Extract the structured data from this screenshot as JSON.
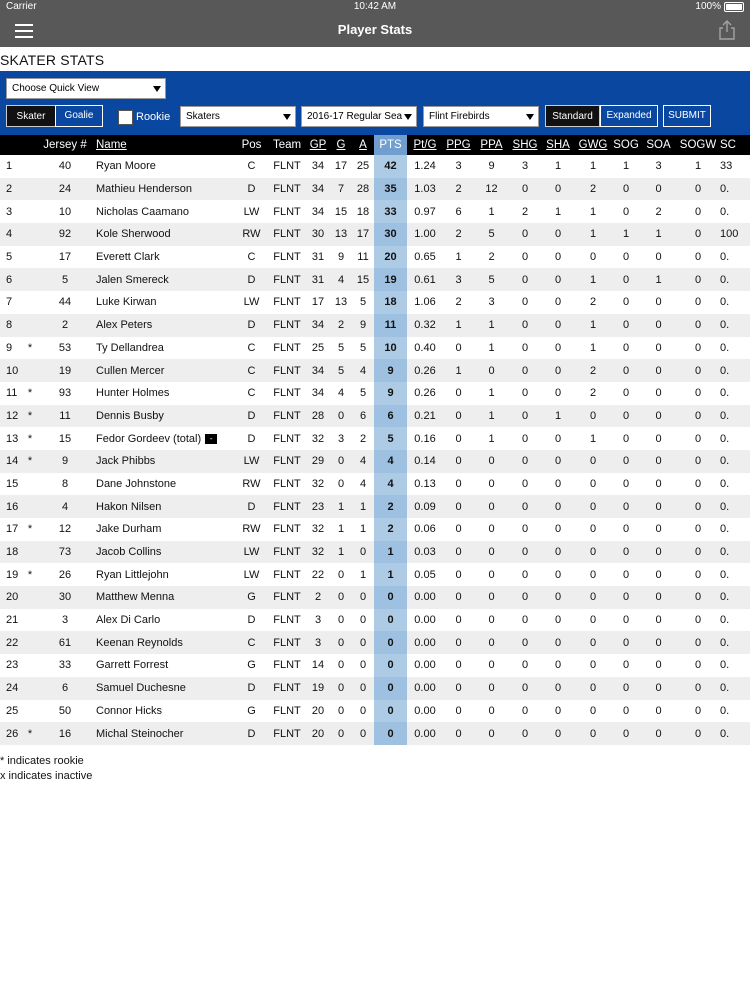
{
  "status": {
    "carrier": "Carrier",
    "time": "10:42 AM",
    "battery": "100%"
  },
  "nav": {
    "title": "Player Stats",
    "menu_icon": "hamburger-icon",
    "share_icon": "share-icon"
  },
  "section_title": "SKATER STATS",
  "toolbar": {
    "quick_view": "Choose Quick View",
    "skater": "Skater",
    "goalie": "Goalie",
    "rookie": "Rookie",
    "type": "Skaters",
    "season": "2016-17 Regular Sea",
    "team": "Flint Firebirds",
    "standard": "Standard",
    "expanded": "Expanded",
    "submit": "SUBMIT"
  },
  "headers": [
    "",
    "",
    "Jersey #",
    "Name",
    "Pos",
    "Team",
    "GP",
    "G",
    "A",
    "PTS",
    "Pt/G",
    "PPG",
    "PPA",
    "SHG",
    "SHA",
    "GWG",
    "SOG",
    "SOA",
    "SOGW",
    "SC"
  ],
  "players": [
    {
      "rank": "1",
      "rookie": "",
      "jersey": "40",
      "name": "Ryan Moore",
      "pos": "C",
      "team": "FLNT",
      "gp": "34",
      "g": "17",
      "a": "25",
      "pts": "42",
      "ptg": "1.24",
      "ppg": "3",
      "ppa": "9",
      "shg": "3",
      "sha": "1",
      "gwg": "1",
      "sog": "1",
      "soa": "3",
      "sogw": "1",
      "sc": "33"
    },
    {
      "rank": "2",
      "rookie": "",
      "jersey": "24",
      "name": "Mathieu Henderson",
      "pos": "D",
      "team": "FLNT",
      "gp": "34",
      "g": "7",
      "a": "28",
      "pts": "35",
      "ptg": "1.03",
      "ppg": "2",
      "ppa": "12",
      "shg": "0",
      "sha": "0",
      "gwg": "2",
      "sog": "0",
      "soa": "0",
      "sogw": "0",
      "sc": "0."
    },
    {
      "rank": "3",
      "rookie": "",
      "jersey": "10",
      "name": "Nicholas Caamano",
      "pos": "LW",
      "team": "FLNT",
      "gp": "34",
      "g": "15",
      "a": "18",
      "pts": "33",
      "ptg": "0.97",
      "ppg": "6",
      "ppa": "1",
      "shg": "2",
      "sha": "1",
      "gwg": "1",
      "sog": "0",
      "soa": "2",
      "sogw": "0",
      "sc": "0."
    },
    {
      "rank": "4",
      "rookie": "",
      "jersey": "92",
      "name": "Kole Sherwood",
      "pos": "RW",
      "team": "FLNT",
      "gp": "30",
      "g": "13",
      "a": "17",
      "pts": "30",
      "ptg": "1.00",
      "ppg": "2",
      "ppa": "5",
      "shg": "0",
      "sha": "0",
      "gwg": "1",
      "sog": "1",
      "soa": "1",
      "sogw": "0",
      "sc": "100"
    },
    {
      "rank": "5",
      "rookie": "",
      "jersey": "17",
      "name": "Everett Clark",
      "pos": "C",
      "team": "FLNT",
      "gp": "31",
      "g": "9",
      "a": "11",
      "pts": "20",
      "ptg": "0.65",
      "ppg": "1",
      "ppa": "2",
      "shg": "0",
      "sha": "0",
      "gwg": "0",
      "sog": "0",
      "soa": "0",
      "sogw": "0",
      "sc": "0."
    },
    {
      "rank": "6",
      "rookie": "",
      "jersey": "5",
      "name": "Jalen Smereck",
      "pos": "D",
      "team": "FLNT",
      "gp": "31",
      "g": "4",
      "a": "15",
      "pts": "19",
      "ptg": "0.61",
      "ppg": "3",
      "ppa": "5",
      "shg": "0",
      "sha": "0",
      "gwg": "1",
      "sog": "0",
      "soa": "1",
      "sogw": "0",
      "sc": "0."
    },
    {
      "rank": "7",
      "rookie": "",
      "jersey": "44",
      "name": "Luke Kirwan",
      "pos": "LW",
      "team": "FLNT",
      "gp": "17",
      "g": "13",
      "a": "5",
      "pts": "18",
      "ptg": "1.06",
      "ppg": "2",
      "ppa": "3",
      "shg": "0",
      "sha": "0",
      "gwg": "2",
      "sog": "0",
      "soa": "0",
      "sogw": "0",
      "sc": "0."
    },
    {
      "rank": "8",
      "rookie": "",
      "jersey": "2",
      "name": "Alex Peters",
      "pos": "D",
      "team": "FLNT",
      "gp": "34",
      "g": "2",
      "a": "9",
      "pts": "11",
      "ptg": "0.32",
      "ppg": "1",
      "ppa": "1",
      "shg": "0",
      "sha": "0",
      "gwg": "1",
      "sog": "0",
      "soa": "0",
      "sogw": "0",
      "sc": "0."
    },
    {
      "rank": "9",
      "rookie": "*",
      "jersey": "53",
      "name": "Ty Dellandrea",
      "pos": "C",
      "team": "FLNT",
      "gp": "25",
      "g": "5",
      "a": "5",
      "pts": "10",
      "ptg": "0.40",
      "ppg": "0",
      "ppa": "1",
      "shg": "0",
      "sha": "0",
      "gwg": "1",
      "sog": "0",
      "soa": "0",
      "sogw": "0",
      "sc": "0."
    },
    {
      "rank": "10",
      "rookie": "",
      "jersey": "19",
      "name": "Cullen Mercer",
      "pos": "C",
      "team": "FLNT",
      "gp": "34",
      "g": "5",
      "a": "4",
      "pts": "9",
      "ptg": "0.26",
      "ppg": "1",
      "ppa": "0",
      "shg": "0",
      "sha": "0",
      "gwg": "2",
      "sog": "0",
      "soa": "0",
      "sogw": "0",
      "sc": "0."
    },
    {
      "rank": "11",
      "rookie": "*",
      "jersey": "93",
      "name": "Hunter Holmes",
      "pos": "C",
      "team": "FLNT",
      "gp": "34",
      "g": "4",
      "a": "5",
      "pts": "9",
      "ptg": "0.26",
      "ppg": "0",
      "ppa": "1",
      "shg": "0",
      "sha": "0",
      "gwg": "2",
      "sog": "0",
      "soa": "0",
      "sogw": "0",
      "sc": "0."
    },
    {
      "rank": "12",
      "rookie": "*",
      "jersey": "11",
      "name": "Dennis Busby",
      "pos": "D",
      "team": "FLNT",
      "gp": "28",
      "g": "0",
      "a": "6",
      "pts": "6",
      "ptg": "0.21",
      "ppg": "0",
      "ppa": "1",
      "shg": "0",
      "sha": "1",
      "gwg": "0",
      "sog": "0",
      "soa": "0",
      "sogw": "0",
      "sc": "0."
    },
    {
      "rank": "13",
      "rookie": "*",
      "jersey": "15",
      "name": "Fedor Gordeev (total)",
      "pos": "D",
      "team": "FLNT",
      "gp": "32",
      "g": "3",
      "a": "2",
      "pts": "5",
      "ptg": "0.16",
      "ppg": "0",
      "ppa": "1",
      "shg": "0",
      "sha": "0",
      "gwg": "1",
      "sog": "0",
      "soa": "0",
      "sogw": "0",
      "sc": "0.",
      "badge": "-"
    },
    {
      "rank": "14",
      "rookie": "*",
      "jersey": "9",
      "name": "Jack Phibbs",
      "pos": "LW",
      "team": "FLNT",
      "gp": "29",
      "g": "0",
      "a": "4",
      "pts": "4",
      "ptg": "0.14",
      "ppg": "0",
      "ppa": "0",
      "shg": "0",
      "sha": "0",
      "gwg": "0",
      "sog": "0",
      "soa": "0",
      "sogw": "0",
      "sc": "0."
    },
    {
      "rank": "15",
      "rookie": "",
      "jersey": "8",
      "name": "Dane Johnstone",
      "pos": "RW",
      "team": "FLNT",
      "gp": "32",
      "g": "0",
      "a": "4",
      "pts": "4",
      "ptg": "0.13",
      "ppg": "0",
      "ppa": "0",
      "shg": "0",
      "sha": "0",
      "gwg": "0",
      "sog": "0",
      "soa": "0",
      "sogw": "0",
      "sc": "0."
    },
    {
      "rank": "16",
      "rookie": "",
      "jersey": "4",
      "name": "Hakon Nilsen",
      "pos": "D",
      "team": "FLNT",
      "gp": "23",
      "g": "1",
      "a": "1",
      "pts": "2",
      "ptg": "0.09",
      "ppg": "0",
      "ppa": "0",
      "shg": "0",
      "sha": "0",
      "gwg": "0",
      "sog": "0",
      "soa": "0",
      "sogw": "0",
      "sc": "0."
    },
    {
      "rank": "17",
      "rookie": "*",
      "jersey": "12",
      "name": "Jake Durham",
      "pos": "RW",
      "team": "FLNT",
      "gp": "32",
      "g": "1",
      "a": "1",
      "pts": "2",
      "ptg": "0.06",
      "ppg": "0",
      "ppa": "0",
      "shg": "0",
      "sha": "0",
      "gwg": "0",
      "sog": "0",
      "soa": "0",
      "sogw": "0",
      "sc": "0."
    },
    {
      "rank": "18",
      "rookie": "",
      "jersey": "73",
      "name": "Jacob Collins",
      "pos": "LW",
      "team": "FLNT",
      "gp": "32",
      "g": "1",
      "a": "0",
      "pts": "1",
      "ptg": "0.03",
      "ppg": "0",
      "ppa": "0",
      "shg": "0",
      "sha": "0",
      "gwg": "0",
      "sog": "0",
      "soa": "0",
      "sogw": "0",
      "sc": "0."
    },
    {
      "rank": "19",
      "rookie": "*",
      "jersey": "26",
      "name": "Ryan Littlejohn",
      "pos": "LW",
      "team": "FLNT",
      "gp": "22",
      "g": "0",
      "a": "1",
      "pts": "1",
      "ptg": "0.05",
      "ppg": "0",
      "ppa": "0",
      "shg": "0",
      "sha": "0",
      "gwg": "0",
      "sog": "0",
      "soa": "0",
      "sogw": "0",
      "sc": "0."
    },
    {
      "rank": "20",
      "rookie": "",
      "jersey": "30",
      "name": "Matthew Menna",
      "pos": "G",
      "team": "FLNT",
      "gp": "2",
      "g": "0",
      "a": "0",
      "pts": "0",
      "ptg": "0.00",
      "ppg": "0",
      "ppa": "0",
      "shg": "0",
      "sha": "0",
      "gwg": "0",
      "sog": "0",
      "soa": "0",
      "sogw": "0",
      "sc": "0."
    },
    {
      "rank": "21",
      "rookie": "",
      "jersey": "3",
      "name": "Alex Di Carlo",
      "pos": "D",
      "team": "FLNT",
      "gp": "3",
      "g": "0",
      "a": "0",
      "pts": "0",
      "ptg": "0.00",
      "ppg": "0",
      "ppa": "0",
      "shg": "0",
      "sha": "0",
      "gwg": "0",
      "sog": "0",
      "soa": "0",
      "sogw": "0",
      "sc": "0."
    },
    {
      "rank": "22",
      "rookie": "",
      "jersey": "61",
      "name": "Keenan Reynolds",
      "pos": "C",
      "team": "FLNT",
      "gp": "3",
      "g": "0",
      "a": "0",
      "pts": "0",
      "ptg": "0.00",
      "ppg": "0",
      "ppa": "0",
      "shg": "0",
      "sha": "0",
      "gwg": "0",
      "sog": "0",
      "soa": "0",
      "sogw": "0",
      "sc": "0."
    },
    {
      "rank": "23",
      "rookie": "",
      "jersey": "33",
      "name": "Garrett Forrest",
      "pos": "G",
      "team": "FLNT",
      "gp": "14",
      "g": "0",
      "a": "0",
      "pts": "0",
      "ptg": "0.00",
      "ppg": "0",
      "ppa": "0",
      "shg": "0",
      "sha": "0",
      "gwg": "0",
      "sog": "0",
      "soa": "0",
      "sogw": "0",
      "sc": "0."
    },
    {
      "rank": "24",
      "rookie": "",
      "jersey": "6",
      "name": "Samuel Duchesne",
      "pos": "D",
      "team": "FLNT",
      "gp": "19",
      "g": "0",
      "a": "0",
      "pts": "0",
      "ptg": "0.00",
      "ppg": "0",
      "ppa": "0",
      "shg": "0",
      "sha": "0",
      "gwg": "0",
      "sog": "0",
      "soa": "0",
      "sogw": "0",
      "sc": "0."
    },
    {
      "rank": "25",
      "rookie": "",
      "jersey": "50",
      "name": "Connor Hicks",
      "pos": "G",
      "team": "FLNT",
      "gp": "20",
      "g": "0",
      "a": "0",
      "pts": "0",
      "ptg": "0.00",
      "ppg": "0",
      "ppa": "0",
      "shg": "0",
      "sha": "0",
      "gwg": "0",
      "sog": "0",
      "soa": "0",
      "sogw": "0",
      "sc": "0."
    },
    {
      "rank": "26",
      "rookie": "*",
      "jersey": "16",
      "name": "Michal Steinocher",
      "pos": "D",
      "team": "FLNT",
      "gp": "20",
      "g": "0",
      "a": "0",
      "pts": "0",
      "ptg": "0.00",
      "ppg": "0",
      "ppa": "0",
      "shg": "0",
      "sha": "0",
      "gwg": "0",
      "sog": "0",
      "soa": "0",
      "sogw": "0",
      "sc": "0."
    }
  ],
  "footnotes": [
    "* indicates rookie",
    "x indicates inactive"
  ],
  "colors": {
    "toolbar": "#0a47a0",
    "pts_column": "#aecbe6",
    "header_bg": "#000000",
    "nav_bg": "#585858"
  }
}
